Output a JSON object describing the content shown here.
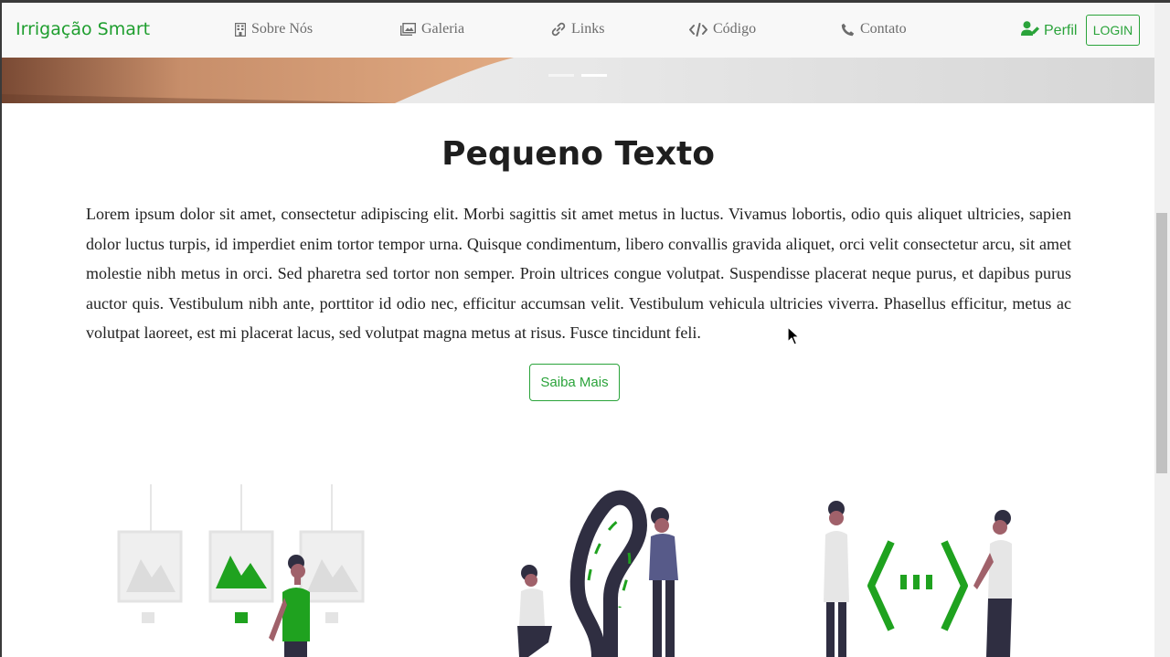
{
  "navbar": {
    "brand": "Irrigação Smart",
    "items": [
      {
        "label": "Sobre Nós",
        "icon": "building-icon"
      },
      {
        "label": "Galeria",
        "icon": "gallery-icon"
      },
      {
        "label": "Links",
        "icon": "link-icon"
      },
      {
        "label": "Código",
        "icon": "code-icon"
      },
      {
        "label": "Contato",
        "icon": "phone-icon"
      }
    ],
    "profile_label": "Perfil",
    "login_label": "LOGIN"
  },
  "main": {
    "title": "Pequeno Texto",
    "paragraph": "Lorem ipsum dolor sit amet, consectetur adipiscing elit. Morbi sagittis sit amet metus in luctus. Vivamus lobortis, odio quis aliquet ultricies, sapien dolor luctus turpis, id imperdiet enim tortor tempor urna. Quisque condimentum, libero convallis gravida aliquet, orci velit consectetur arcu, sit amet molestie nibh metus in orci. Sed pharetra sed tortor non semper. Proin ultrices congue volutpat. Suspendisse placerat neque purus, et dapibus purus auctor quis. Vestibulum nibh ante, porttitor id odio nec, efficitur accumsan velit. Vestibulum vehicula ultricies viverra. Phasellus efficitur, metus ac volutpat laoreet, est mi placerat lacus, sed volutpat magna metus at risus. Fusce tincidunt feli.",
    "button_label": "Saiba Mais"
  },
  "colors": {
    "brand_green": "#2aa33a",
    "accent_green": "#1fa21f",
    "navbar_bg": "#f8f8f8"
  }
}
